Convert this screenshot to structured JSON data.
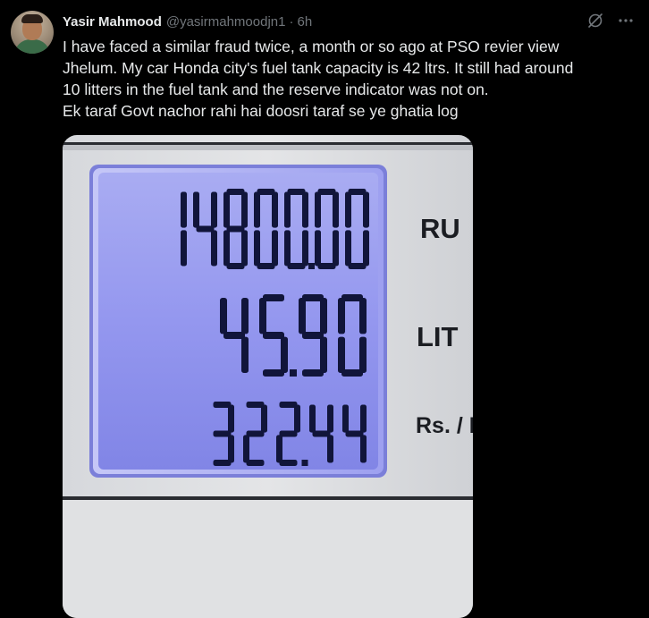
{
  "tweet": {
    "author_name": "Yasir Mahmood",
    "author_handle": "@yasirmahmoodjn1",
    "separator": "·",
    "time": "6h",
    "text_lines": [
      "I have faced a similar fraud twice,  a month or so ago at PSO revier view",
      "Jhelum. My car Honda city's fuel tank capacity is 42 ltrs. It still had around",
      "10 litters in the fuel tank and the reserve indicator was not on.",
      "Ek taraf Govt nachor rahi hai doosri taraf se ye ghatia log"
    ]
  },
  "icons": {
    "grok": "slashed-circle-icon",
    "more": "more-horizontal-icon"
  },
  "photo": {
    "display": {
      "amount": "14800.00",
      "litres": "45.90",
      "rate": "322.44"
    },
    "labels": {
      "amount": "RU",
      "litres": "LIT",
      "rate": "Rs. / L"
    }
  },
  "colors": {
    "background": "#000000",
    "text": "#e7e9ea",
    "muted": "#71767b",
    "lcd": "#8d92ee",
    "segment": "#11153a"
  }
}
